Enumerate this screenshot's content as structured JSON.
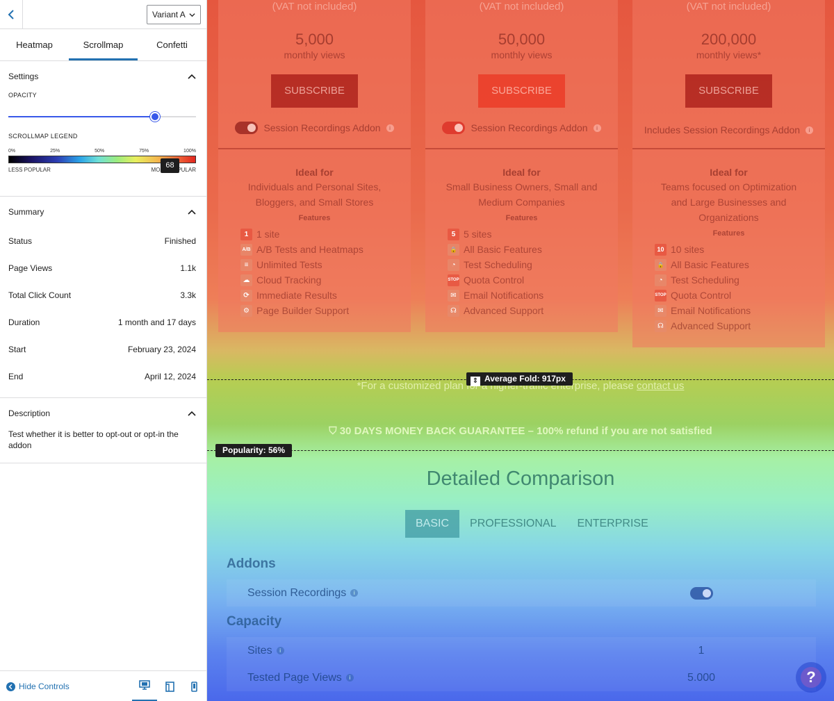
{
  "sidebar": {
    "variant": "Variant A",
    "tabs": [
      "Heatmap",
      "Scrollmap",
      "Confetti"
    ],
    "settings": {
      "title": "Settings",
      "opacity_label": "OPACITY",
      "opacity_value": "68",
      "legend_label": "SCROLLMAP LEGEND",
      "legend_ticks": [
        "0%",
        "25%",
        "50%",
        "75%",
        "100%"
      ],
      "less": "LESS POPULAR",
      "more": "MORE POPULAR"
    },
    "summary": {
      "title": "Summary",
      "rows": [
        {
          "k": "Status",
          "v": "Finished"
        },
        {
          "k": "Page Views",
          "v": "1.1k"
        },
        {
          "k": "Total Click Count",
          "v": "3.3k"
        },
        {
          "k": "Duration",
          "v": "1 month and 17 days"
        },
        {
          "k": "Start",
          "v": "February 23, 2024"
        },
        {
          "k": "End",
          "v": "April 12, 2024"
        }
      ]
    },
    "description": {
      "title": "Description",
      "text": "Test whether it is better to opt-out or opt-in the addon"
    },
    "hide_controls": "Hide Controls"
  },
  "plans": [
    {
      "vat": "(VAT not included)",
      "views": "5,000",
      "views_label": "monthly views",
      "subscribe": "SUBSCRIBE",
      "addon": "Session Recordings Addon",
      "ideal": "Ideal for",
      "ideal_desc": "Individuals and Personal Sites, Bloggers, and Small Stores",
      "features_label": "Features",
      "features": [
        {
          "icon": "1",
          "text": "1 site"
        },
        {
          "icon": "A/B",
          "text": "A/B Tests and Heatmaps"
        },
        {
          "icon": "≡",
          "text": "Unlimited Tests"
        },
        {
          "icon": "☁",
          "text": "Cloud Tracking"
        },
        {
          "icon": "⟳",
          "text": "Immediate Results"
        },
        {
          "icon": "⚙",
          "text": "Page Builder Support"
        }
      ]
    },
    {
      "vat": "(VAT not included)",
      "views": "50,000",
      "views_label": "monthly views",
      "subscribe": "SUBSCRIBE",
      "addon": "Session Recordings Addon",
      "ideal": "Ideal for",
      "ideal_desc": "Small Business Owners, Small and Medium Companies",
      "features_label": "Features",
      "features": [
        {
          "icon": "5",
          "text": "5 sites"
        },
        {
          "icon": "🔒",
          "text": "All Basic Features"
        },
        {
          "icon": "◔",
          "text": "Test Scheduling"
        },
        {
          "icon": "STOP",
          "text": "Quota Control"
        },
        {
          "icon": "✉",
          "text": "Email Notifications"
        },
        {
          "icon": "☊",
          "text": "Advanced Support"
        }
      ]
    },
    {
      "vat": "(VAT not included)",
      "views": "200,000",
      "views_label": "monthly views*",
      "subscribe": "SUBSCRIBE",
      "addon": "Includes Session Recordings Addon",
      "ideal": "Ideal for",
      "ideal_desc": "Teams focused on Optimization and Large Businesses and Organizations",
      "features_label": "Features",
      "features": [
        {
          "icon": "10",
          "text": "10 sites"
        },
        {
          "icon": "🔒",
          "text": "All Basic Features"
        },
        {
          "icon": "◔",
          "text": "Test Scheduling"
        },
        {
          "icon": "STOP",
          "text": "Quota Control"
        },
        {
          "icon": "✉",
          "text": "Email Notifications"
        },
        {
          "icon": "☊",
          "text": "Advanced Support"
        }
      ]
    }
  ],
  "fold_label": "Average Fold: 917px",
  "popularity_label": "Popularity: 56%",
  "custom_plan_note": "*For a customized plan for a higher-traffic enterprise, please",
  "contact_link": "contact us",
  "guarantee": "30 DAYS MONEY BACK GUARANTEE – 100% refund if you are not satisfied",
  "comparison": {
    "title": "Detailed Comparison",
    "tabs": [
      "BASIC",
      "PROFESSIONAL",
      "ENTERPRISE"
    ],
    "addons_heading": "Addons",
    "session_recordings": "Session Recordings",
    "capacity_heading": "Capacity",
    "sites_label": "Sites",
    "sites_value": "1",
    "tested_label": "Tested Page Views",
    "tested_value": "5.000"
  },
  "colors": {
    "accent": "#2271b1",
    "slider": "#3858e9"
  }
}
